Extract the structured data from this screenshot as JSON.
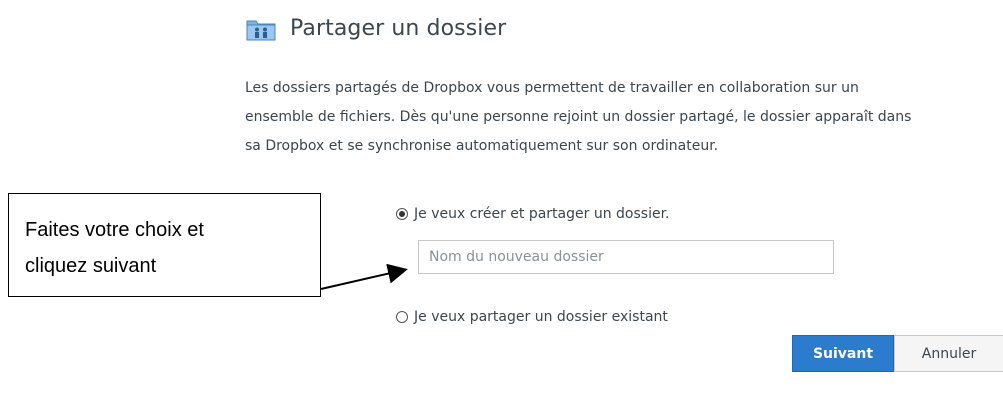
{
  "dialog": {
    "title": "Partager un dossier",
    "icon": "shared-folder-icon",
    "description_lines": [
      "Les dossiers partagés de Dropbox vous permettent de travailler en collaboration sur un",
      "ensemble de fichiers. Dès qu'une personne rejoint un dossier partagé, le dossier apparaît dans",
      "sa Dropbox et se synchronise automatiquement sur son ordinateur."
    ],
    "options": {
      "create_label": "Je veux créer et partager un dossier.",
      "create_selected": true,
      "existing_label": "Je veux partager un dossier existant",
      "existing_selected": false
    },
    "new_folder_input": {
      "value": "",
      "placeholder": "Nom du nouveau dossier"
    },
    "buttons": {
      "next_label": "Suivant",
      "cancel_label": "Annuler"
    }
  },
  "annotation": {
    "lines": [
      "Faites votre choix et",
      "cliquez suivant"
    ]
  },
  "colors": {
    "primary_button": "#2b7ccc",
    "text": "#3d464d"
  }
}
